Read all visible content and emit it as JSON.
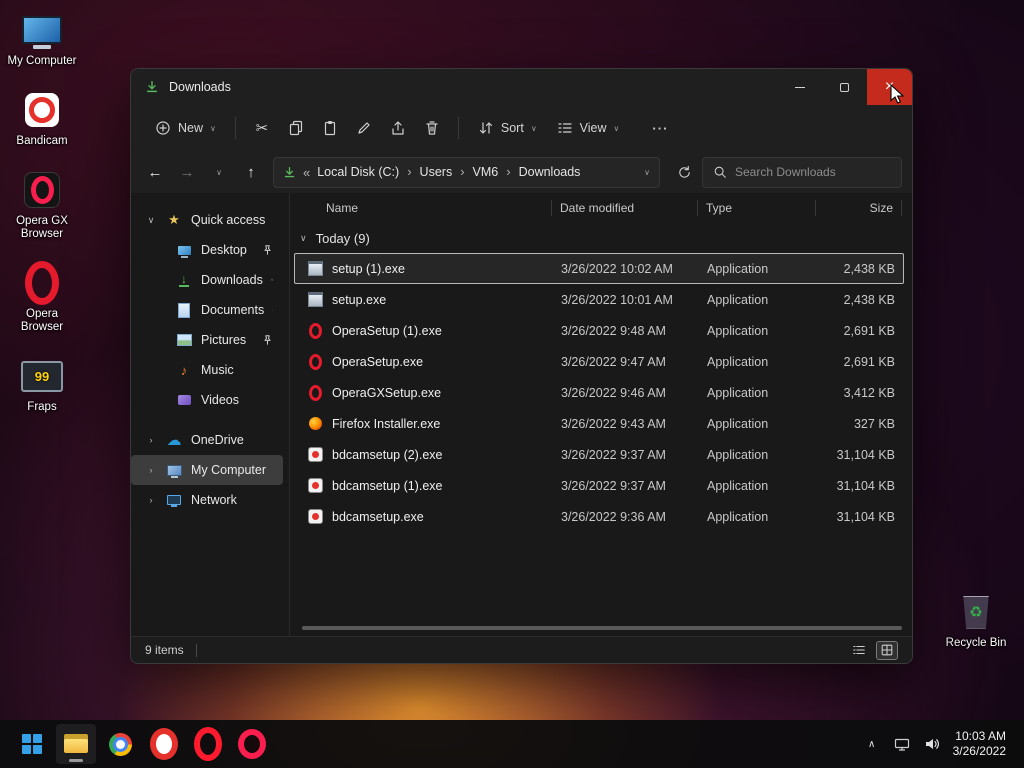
{
  "desktop": {
    "icons": [
      {
        "label": "My Computer",
        "icon": "computer"
      },
      {
        "label": "Bandicam",
        "icon": "bandicam"
      },
      {
        "label": "Opera GX Browser",
        "icon": "operagx"
      },
      {
        "label": "Opera Browser",
        "icon": "opera"
      },
      {
        "label": "Fraps",
        "icon": "fraps"
      }
    ],
    "recycle_bin": {
      "label": "Recycle Bin",
      "icon": "recycle"
    }
  },
  "explorer": {
    "title": "Downloads",
    "toolbar": {
      "new_label": "New",
      "sort_label": "Sort",
      "view_label": "View"
    },
    "address": {
      "crumbs": [
        "Local Disk (C:)",
        "Users",
        "VM6",
        "Downloads"
      ],
      "search_placeholder": "Search Downloads"
    },
    "sidebar": {
      "quick_access_label": "Quick access",
      "quick_items": [
        {
          "label": "Desktop",
          "icon": "desktop",
          "pinned": true
        },
        {
          "label": "Downloads",
          "icon": "download",
          "pinned": true
        },
        {
          "label": "Documents",
          "icon": "document",
          "pinned": true
        },
        {
          "label": "Pictures",
          "icon": "picture",
          "pinned": true
        },
        {
          "label": "Music",
          "icon": "music",
          "pinned": false
        },
        {
          "label": "Videos",
          "icon": "video",
          "pinned": false
        }
      ],
      "tree_items": [
        {
          "label": "OneDrive",
          "icon": "cloud",
          "chev": "›",
          "selected": false
        },
        {
          "label": "My Computer",
          "icon": "computer",
          "chev": "›",
          "selected": true
        },
        {
          "label": "Network",
          "icon": "network",
          "chev": "›",
          "selected": false
        }
      ]
    },
    "list": {
      "columns": {
        "name": "Name",
        "date": "Date modified",
        "type": "Type",
        "size": "Size"
      },
      "group_label": "Today (9)",
      "files": [
        {
          "name": "setup (1).exe",
          "modified": "3/26/2022 10:02 AM",
          "type": "Application",
          "size": "2,438 KB",
          "icon": "installer",
          "selected": true
        },
        {
          "name": "setup.exe",
          "modified": "3/26/2022 10:01 AM",
          "type": "Application",
          "size": "2,438 KB",
          "icon": "installer",
          "selected": false
        },
        {
          "name": "OperaSetup (1).exe",
          "modified": "3/26/2022 9:48 AM",
          "type": "Application",
          "size": "2,691 KB",
          "icon": "opera",
          "selected": false
        },
        {
          "name": "OperaSetup.exe",
          "modified": "3/26/2022 9:47 AM",
          "type": "Application",
          "size": "2,691 KB",
          "icon": "opera",
          "selected": false
        },
        {
          "name": "OperaGXSetup.exe",
          "modified": "3/26/2022 9:46 AM",
          "type": "Application",
          "size": "3,412 KB",
          "icon": "opera",
          "selected": false
        },
        {
          "name": "Firefox Installer.exe",
          "modified": "3/26/2022 9:43 AM",
          "type": "Application",
          "size": "327 KB",
          "icon": "firefox",
          "selected": false
        },
        {
          "name": "bdcamsetup (2).exe",
          "modified": "3/26/2022 9:37 AM",
          "type": "Application",
          "size": "31,104 KB",
          "icon": "bdcam",
          "selected": false
        },
        {
          "name": "bdcamsetup (1).exe",
          "modified": "3/26/2022 9:37 AM",
          "type": "Application",
          "size": "31,104 KB",
          "icon": "bdcam",
          "selected": false
        },
        {
          "name": "bdcamsetup.exe",
          "modified": "3/26/2022 9:36 AM",
          "type": "Application",
          "size": "31,104 KB",
          "icon": "bdcam",
          "selected": false
        }
      ]
    },
    "status": {
      "items_label": "9 items"
    }
  },
  "taskbar": {
    "apps": [
      {
        "name": "file-explorer",
        "icon": "explorer",
        "active": true
      },
      {
        "name": "chrome",
        "icon": "chrome",
        "active": false
      },
      {
        "name": "bandicam",
        "icon": "bandicam",
        "active": false
      },
      {
        "name": "opera",
        "icon": "opera",
        "active": false
      },
      {
        "name": "opera-gx",
        "icon": "operagx",
        "active": false
      }
    ],
    "clock": {
      "time": "10:03 AM",
      "date": "3/26/2022"
    }
  },
  "colors": {
    "close_button": "#c42b1c",
    "selection_border": "#b8b8b8",
    "accent_download_green": "#58b85c"
  }
}
